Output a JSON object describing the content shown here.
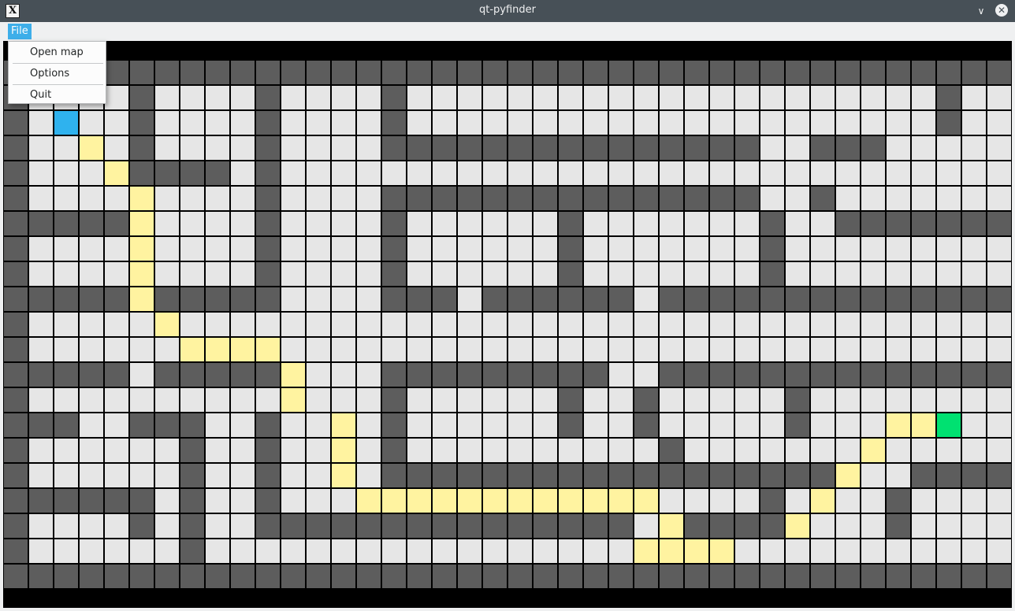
{
  "window": {
    "title": "qt-pyfinder",
    "minimize_icon": "chevron-down-icon",
    "close_icon": "close-icon",
    "app_icon": "x-app-icon"
  },
  "menubar": {
    "file_label": "File"
  },
  "file_menu": {
    "items": [
      {
        "label": "Open map"
      },
      {
        "label": "Options"
      },
      {
        "label": "Quit"
      }
    ]
  },
  "colors": {
    "wall": "#5d5d5d",
    "open": "#e6e6e6",
    "path": "#fff3a0",
    "start": "#2fb2ee",
    "goal": "#00e171",
    "gridline": "#000000",
    "titlebar": "#475057",
    "menu_highlight": "#3daee9"
  },
  "grid": {
    "legend": "W=wall, .=open, P=path, S=start, G=goal",
    "rows": [
      "WWWWWWWWWWWWWWWWWWWWWWWWWWWWWWWWWWWWWWWW",
      "W....W....W....W.....................W..",
      "W.S..W....W....W.....................W..",
      "W..P.W....W....WWWWWWWWWWWWWWW..WWW.....",
      "W...PWWWW.W.............................",
      "W....P....W....WWWWWWWWWWWWWWW..W.......",
      "WWWWWP....W....W......W.......W..WWWWWWW",
      "W....P....W....W......W.......W.........",
      "W....P....W....W......W.......W.........",
      "WWWWWPWWWWW....WWW.WWWWWW.WWWWWWWWWWWWWW",
      "W.....P.................................",
      "W......PPPP.............................",
      "WWWWW.WWWWWP...WWWWWWWWW..WWWWWWWWWWWWWW",
      "W..........P...W......W..W.....W........",
      "WWW..WWW..W..P.W......W..W.....W...PPG..",
      "W......W..W..P.W..........W.......P.....",
      "W......W..W..P.WWWWWWWWWWWWWWWWWWP..WWWW",
      "WWWWWW.W..W...PPPPPPPPPPPP....W.P..W....",
      "W....W.W..WWWWWWWWWWWWWWW.PWWWWP...W....",
      "W......W.................PPPP...........",
      "WWWWWWWWWWWWWWWWWWWWWWWWWWWWWWWWWWWWWWWW"
    ]
  }
}
